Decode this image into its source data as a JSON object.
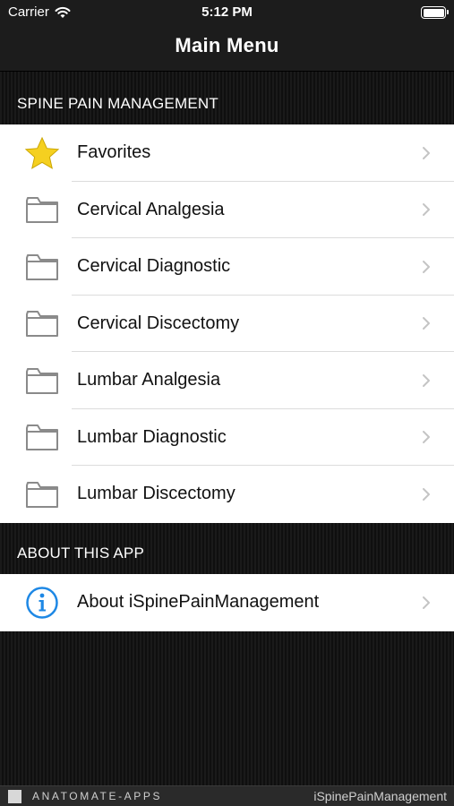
{
  "status": {
    "carrier": "Carrier",
    "time": "5:12 PM"
  },
  "nav": {
    "title": "Main Menu"
  },
  "sections": [
    {
      "header": "SPINE PAIN MANAGEMENT",
      "items": [
        {
          "label": "Favorites",
          "icon": "star-icon"
        },
        {
          "label": "Cervical Analgesia",
          "icon": "folder-icon"
        },
        {
          "label": "Cervical Diagnostic",
          "icon": "folder-icon"
        },
        {
          "label": "Cervical Discectomy",
          "icon": "folder-icon"
        },
        {
          "label": "Lumbar Analgesia",
          "icon": "folder-icon"
        },
        {
          "label": "Lumbar Diagnostic",
          "icon": "folder-icon"
        },
        {
          "label": "Lumbar Discectomy",
          "icon": "folder-icon"
        }
      ]
    },
    {
      "header": "ABOUT THIS APP",
      "items": [
        {
          "label": "About iSpinePainManagement",
          "icon": "info-icon"
        }
      ]
    }
  ],
  "footer": {
    "brand": "ANATOMATE-APPS",
    "app_name": "iSpinePainManagement"
  },
  "colors": {
    "star": "#f5d020",
    "info": "#1e88e5",
    "folder": "#8a8a8a",
    "chevron": "#c4c4c4"
  }
}
